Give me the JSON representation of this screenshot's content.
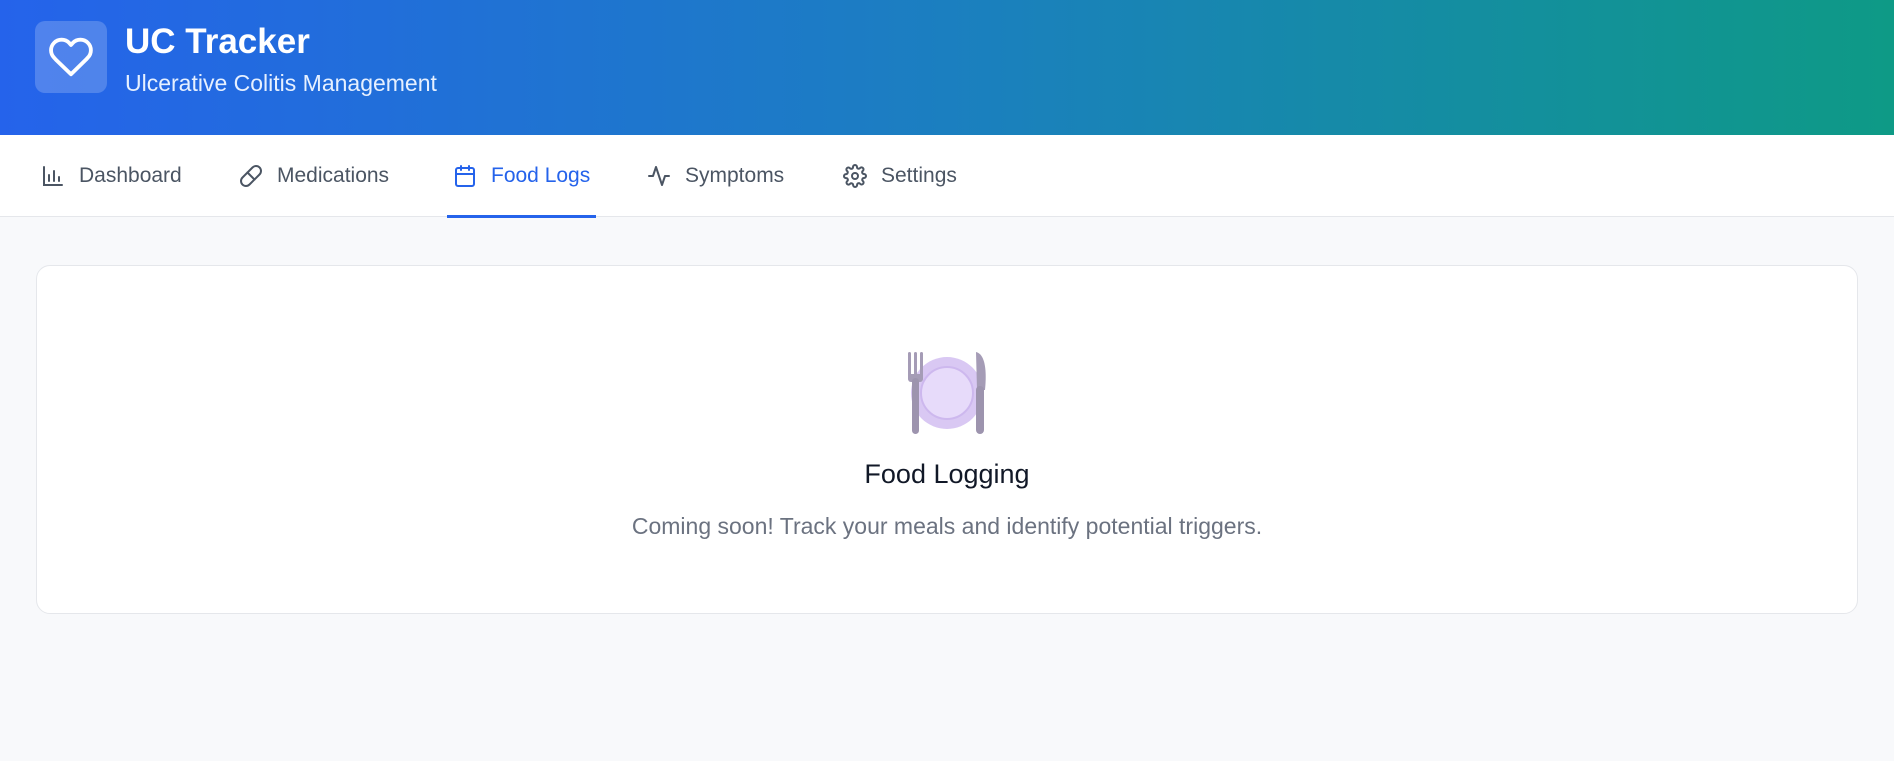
{
  "app": {
    "title": "UC Tracker",
    "subtitle": "Ulcerative Colitis Management",
    "logo_icon": "heart-icon"
  },
  "nav": {
    "tabs": [
      {
        "label": "Dashboard",
        "icon": "bar-chart-icon",
        "active": false
      },
      {
        "label": "Medications",
        "icon": "pill-icon",
        "active": false
      },
      {
        "label": "Food Logs",
        "icon": "calendar-icon",
        "active": true
      },
      {
        "label": "Symptoms",
        "icon": "activity-icon",
        "active": false
      },
      {
        "label": "Settings",
        "icon": "gear-icon",
        "active": false
      }
    ]
  },
  "main": {
    "empty_state": {
      "icon": "fork-knife-plate-icon",
      "title": "Food Logging",
      "description": "Coming soon! Track your meals and identify potential triggers."
    }
  },
  "colors": {
    "accent": "#2563eb",
    "header_gradient_start": "#2563eb",
    "header_gradient_end": "#0e9a86"
  }
}
